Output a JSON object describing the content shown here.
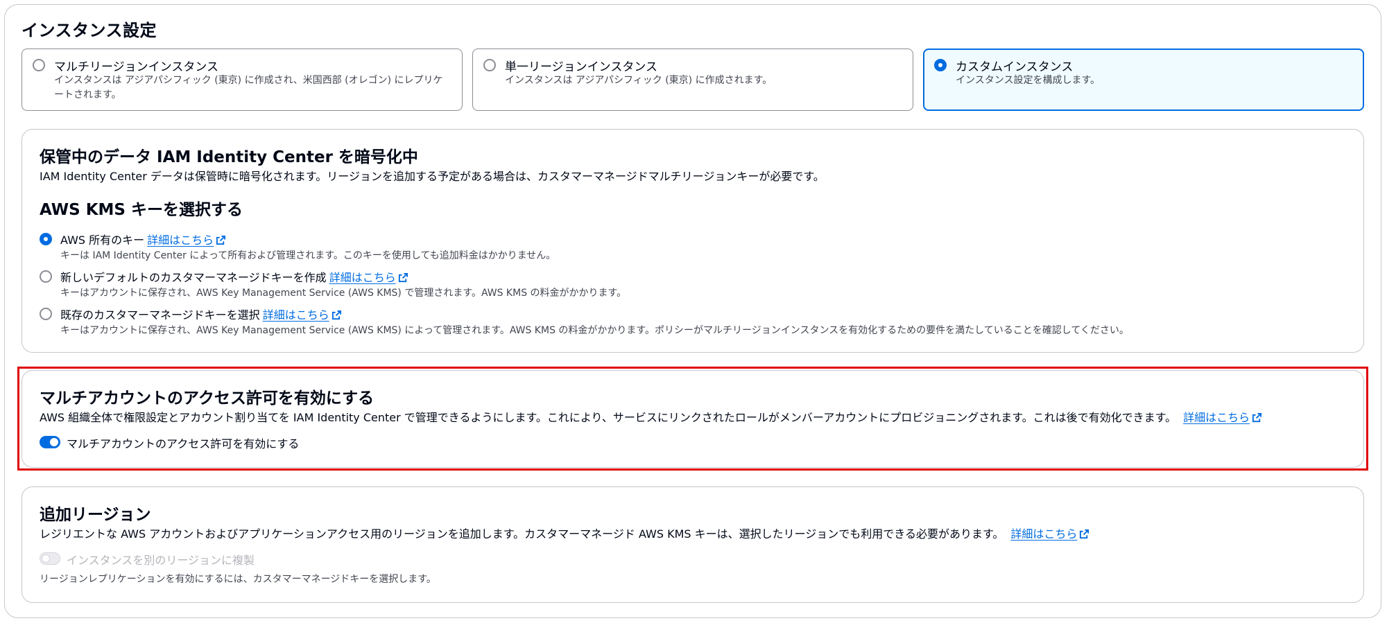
{
  "section_title": "インスタンス設定",
  "instance_tiles": [
    {
      "label": "マルチリージョンインスタンス",
      "desc": "インスタンスは アジアパシフィック (東京) に作成され、米国西部 (オレゴン) にレプリケートされます。"
    },
    {
      "label": "単一リージョンインスタンス",
      "desc": "インスタンスは アジアパシフィック (東京) に作成されます。"
    },
    {
      "label": "カスタムインスタンス",
      "desc": "インスタンス設定を構成します。"
    }
  ],
  "selected_instance": "カスタムインスタンス",
  "encryption": {
    "title": "保管中のデータ IAM Identity Center を暗号化中",
    "desc": "IAM Identity Center データは保管時に暗号化されます。リージョンを追加する予定がある場合は、カスタマーマネージドマルチリージョンキーが必要です。",
    "kms_title": "AWS KMS キーを選択する",
    "options": [
      {
        "label": "AWS 所有のキー",
        "link": "詳細はこちら",
        "desc": "キーは IAM Identity Center によって所有および管理されます。このキーを使用しても追加料金はかかりません。"
      },
      {
        "label": "新しいデフォルトのカスタマーマネージドキーを作成",
        "link": "詳細はこちら",
        "desc": "キーはアカウントに保存され、AWS Key Management Service (AWS KMS) で管理されます。AWS KMS の料金がかかります。"
      },
      {
        "label": "既存のカスタマーマネージドキーを選択",
        "link": "詳細はこちら",
        "desc": "キーはアカウントに保存され、AWS Key Management Service (AWS KMS) によって管理されます。AWS KMS の料金がかかります。ポリシーがマルチリージョンインスタンスを有効化するための要件を満たしていることを確認してください。"
      }
    ]
  },
  "multi_account": {
    "title": "マルチアカウントのアクセス許可を有効にする",
    "desc": "AWS 組織全体で権限設定とアカウント割り当てを IAM Identity Center で管理できるようにします。これにより、サービスにリンクされたロールがメンバーアカウントにプロビジョニングされます。これは後で有効化できます。",
    "link": "詳細はこちら",
    "toggle_label": "マルチアカウントのアクセス許可を有効にする"
  },
  "regions": {
    "title": "追加リージョン",
    "desc": "レジリエントな AWS アカウントおよびアプリケーションアクセス用のリージョンを追加します。カスタマーマネージド AWS KMS キーは、選択したリージョンでも利用できる必要があります。",
    "link": "詳細はこちら",
    "toggle_label": "インスタンスを別のリージョンに複製",
    "hint": "リージョンレプリケーションを有効にするには、カスタマーマネージドキーを選択します。"
  },
  "colors": {
    "accent": "#006ce0",
    "highlight": "#e00000",
    "border": "#c6c6cd"
  }
}
